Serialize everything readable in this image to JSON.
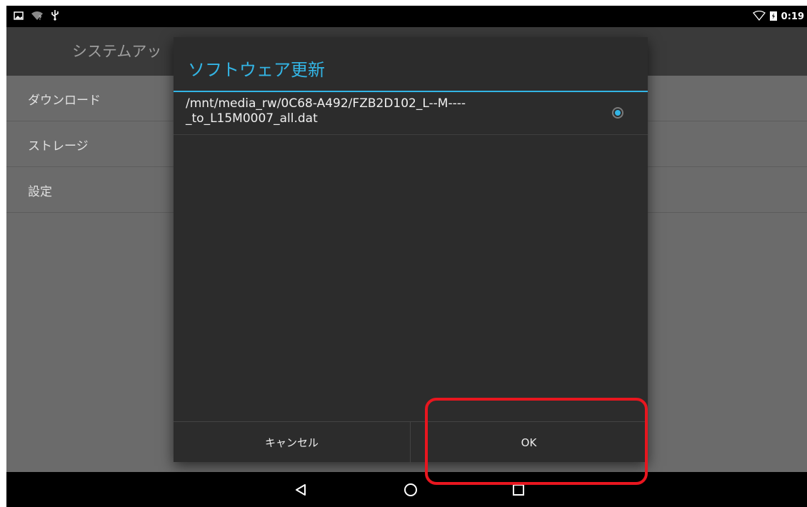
{
  "status_bar": {
    "time": "0:19",
    "icons_left": [
      "image-icon",
      "wifi-question-icon",
      "usb-icon"
    ],
    "icons_right": [
      "wifi-outline-icon",
      "battery-charging-icon"
    ]
  },
  "action_bar": {
    "title": "システムアッ"
  },
  "menu": {
    "items": [
      {
        "label": "ダウンロード"
      },
      {
        "label": "ストレージ"
      },
      {
        "label": "設定"
      }
    ]
  },
  "dialog": {
    "title": "ソフトウェア更新",
    "file_path": "/mnt/media_rw/0C68-A492/FZB2D102_L--M----_to_L15M0007_all.dat",
    "file_path_line1": "/mnt/media_rw/0C68-A492/FZB2D102_L--M----",
    "file_path_line2": "_to_L15M0007_all.dat",
    "selected": true,
    "cancel_label": "キャンセル",
    "ok_label": "OK"
  },
  "navigation": {
    "buttons": [
      "back-icon",
      "home-icon",
      "recents-icon"
    ]
  },
  "colors": {
    "accent": "#33b5e5",
    "highlight": "#e8161f",
    "dialog_bg": "#2c2c2c",
    "content_bg": "#6b6b6b"
  }
}
